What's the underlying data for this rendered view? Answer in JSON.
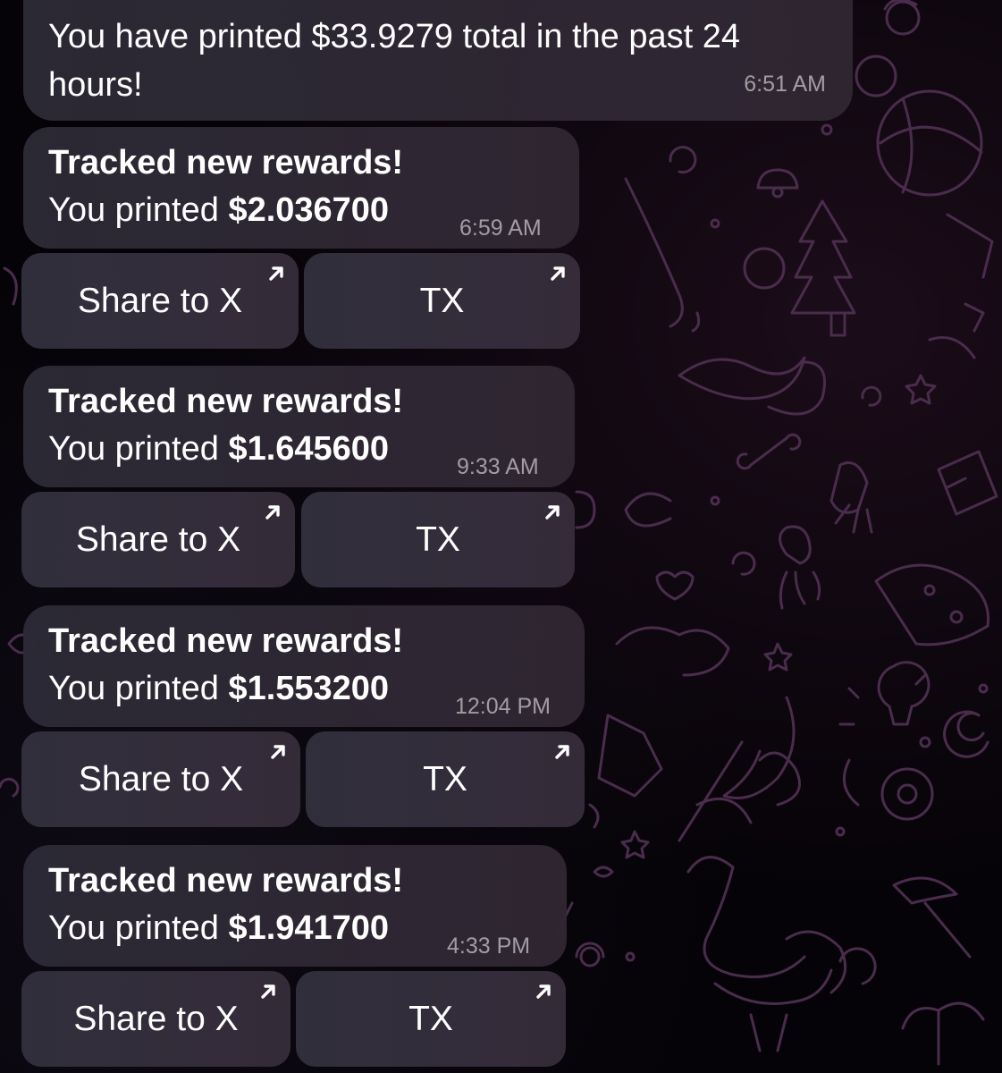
{
  "summary": {
    "text": "You have printed $33.9279 total in the past 24 hours!",
    "time": "6:51 AM"
  },
  "rewards": [
    {
      "title": "Tracked new rewards!",
      "prefix": "You printed",
      "amount": "$2.036700",
      "time": "6:59 AM",
      "share_label": "Share to X",
      "tx_label": "TX"
    },
    {
      "title": "Tracked new rewards!",
      "prefix": "You printed",
      "amount": "$1.645600",
      "time": "9:33 AM",
      "share_label": "Share to X",
      "tx_label": "TX"
    },
    {
      "title": "Tracked new rewards!",
      "prefix": "You printed",
      "amount": "$1.553200",
      "time": "12:04 PM",
      "share_label": "Share to X",
      "tx_label": "TX"
    },
    {
      "title": "Tracked new rewards!",
      "prefix": "You printed",
      "amount": "$1.941700",
      "time": "4:33 PM",
      "share_label": "Share to X",
      "tx_label": "TX"
    }
  ],
  "icons": {
    "button_link": "arrow-up-right-icon"
  },
  "colors": {
    "background": "#050307",
    "bubble": "#2c2a36",
    "doodle": "#4a2c4c",
    "text": "#ffffff"
  }
}
